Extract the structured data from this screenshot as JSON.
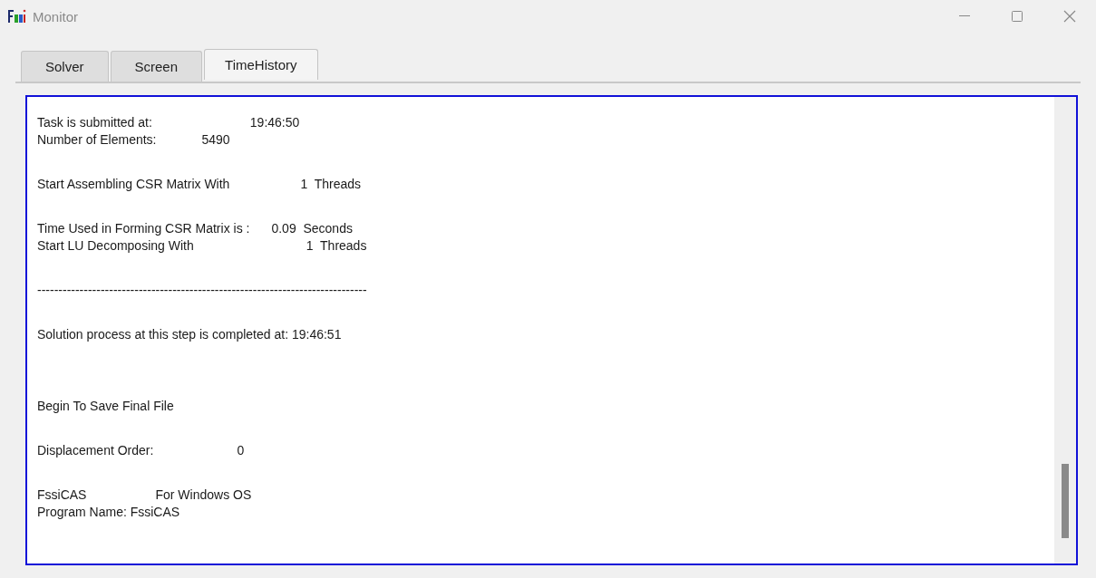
{
  "window": {
    "title": "Monitor"
  },
  "tabs": [
    {
      "label": "Solver",
      "selected": false
    },
    {
      "label": "Screen",
      "selected": false
    },
    {
      "label": "TimeHistory",
      "selected": true
    }
  ],
  "log": [
    {
      "kind": "pair",
      "label": "Task is submitted at:",
      "value": "19:46:50"
    },
    {
      "kind": "pair",
      "label": "Number of Elements:",
      "value": "5490"
    },
    {
      "kind": "blank"
    },
    {
      "kind": "pair",
      "label": "Start Assembling CSR Matrix With",
      "value": "1  Threads"
    },
    {
      "kind": "blank"
    },
    {
      "kind": "pair",
      "label": "Time Used in Forming CSR Matrix is :",
      "value": "0.09  Seconds"
    },
    {
      "kind": "pair",
      "label": "Start LU Decomposing With",
      "value": "1  Threads"
    },
    {
      "kind": "blank"
    },
    {
      "kind": "text",
      "text": "------------------------------------------------------------------------------"
    },
    {
      "kind": "blank"
    },
    {
      "kind": "text",
      "text": "Solution process at this step is completed at: 19:46:51"
    },
    {
      "kind": "blank"
    },
    {
      "kind": "blank"
    },
    {
      "kind": "text",
      "text": "Begin To Save Final File"
    },
    {
      "kind": "blank"
    },
    {
      "kind": "pair",
      "label": "Displacement Order:",
      "value": "0"
    },
    {
      "kind": "blank"
    },
    {
      "kind": "pair",
      "label": "FssiCAS",
      "value": "For Windows OS"
    },
    {
      "kind": "text",
      "text": "Program Name: FssiCAS"
    }
  ]
}
